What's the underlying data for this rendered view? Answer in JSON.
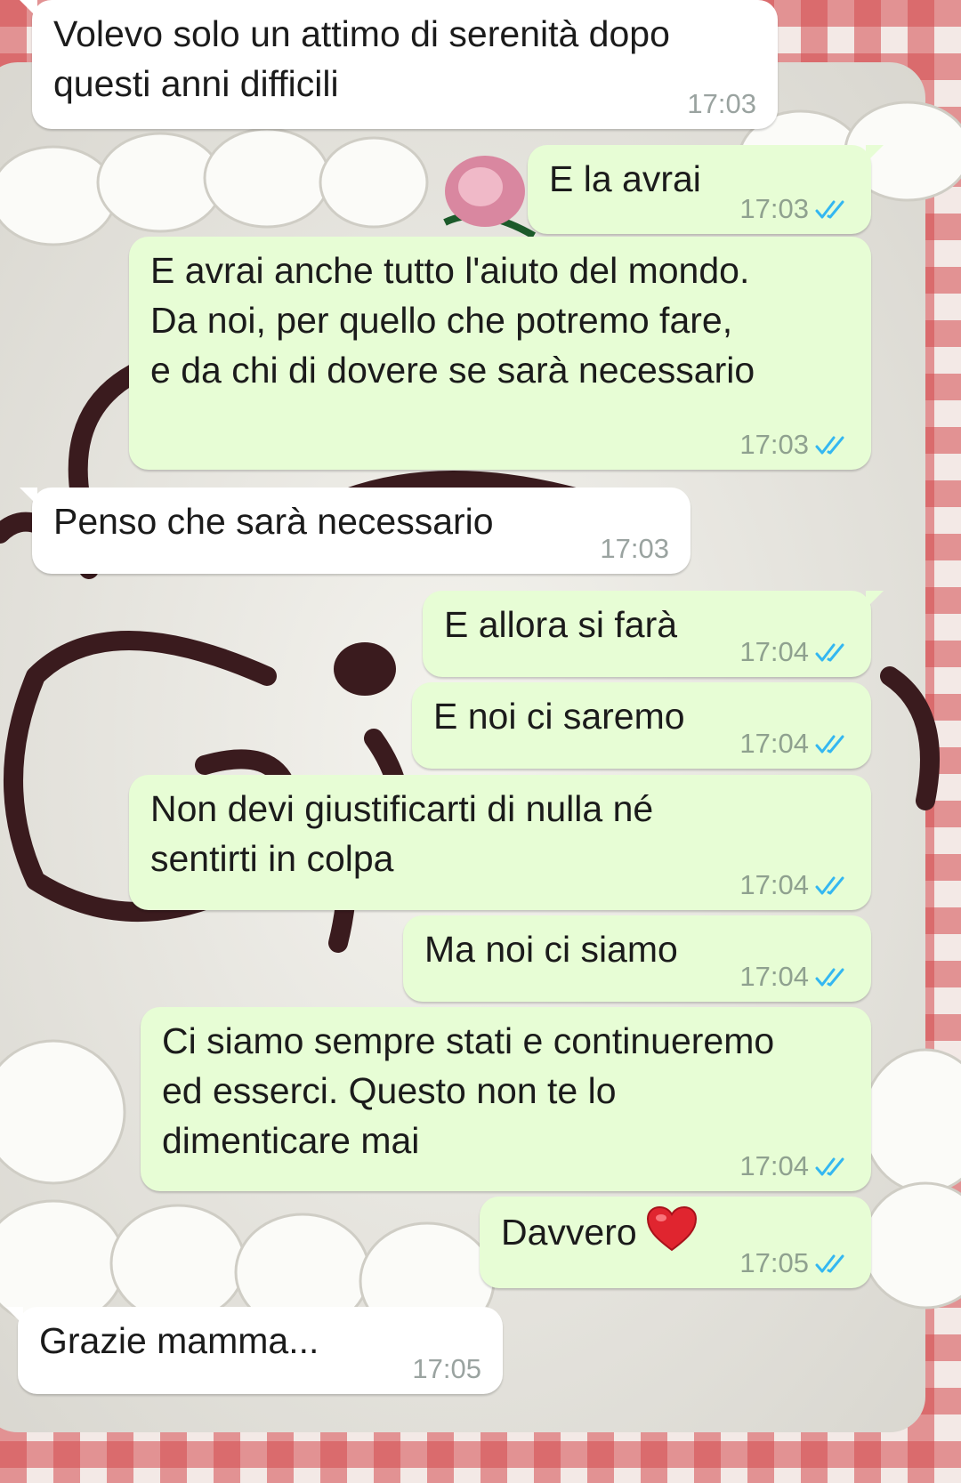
{
  "colors": {
    "incoming_bubble": "#ffffff",
    "outgoing_bubble": "#e7fdd5",
    "timestamp": "#9aa3a0",
    "read_ticks": "#34b7f1",
    "wallpaper_cake": "#f2f1ec",
    "wallpaper_chocolate": "#3a1b1e",
    "wallpaper_tablecloth": "#c3333a"
  },
  "messages": [
    {
      "direction": "in",
      "text": "Volevo solo un attimo di serenità dopo\nquesti anni difficili",
      "time": "17:03"
    },
    {
      "direction": "out",
      "text": "E la avrai",
      "time": "17:03",
      "status": "read"
    },
    {
      "direction": "out",
      "text": "E avrai anche tutto l'aiuto del mondo.\nDa noi, per quello che potremo fare,\ne da chi di dovere se sarà necessario",
      "time": "17:03",
      "status": "read"
    },
    {
      "direction": "in",
      "text": "Penso che sarà necessario",
      "time": "17:03"
    },
    {
      "direction": "out",
      "text": "E allora si farà",
      "time": "17:04",
      "status": "read"
    },
    {
      "direction": "out",
      "text": "E noi ci saremo",
      "time": "17:04",
      "status": "read"
    },
    {
      "direction": "out",
      "text": "Non devi giustificarti di nulla né\nsentirti in colpa",
      "time": "17:04",
      "status": "read"
    },
    {
      "direction": "out",
      "text": "Ma noi ci siamo",
      "time": "17:04",
      "status": "read"
    },
    {
      "direction": "out",
      "text": "Ci siamo sempre stati e continueremo\ned esserci. Questo non te lo\ndimenticare mai",
      "time": "17:04",
      "status": "read"
    },
    {
      "direction": "out",
      "text": "Davvero",
      "emoji": "red-heart-icon",
      "time": "17:05",
      "status": "read"
    },
    {
      "direction": "in",
      "text": "Grazie mamma...",
      "time": "17:05"
    }
  ]
}
